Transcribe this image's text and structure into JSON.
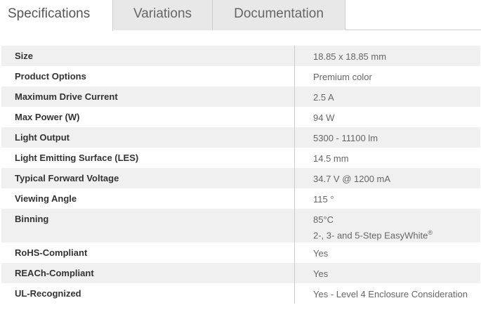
{
  "tabs": [
    {
      "label": "Specifications",
      "active": true
    },
    {
      "label": "Variations",
      "active": false
    },
    {
      "label": "Documentation",
      "active": false
    }
  ],
  "specs": [
    {
      "label": "Size",
      "value": "18.85 x 18.85 mm"
    },
    {
      "label": "Product Options",
      "value": "Premium color"
    },
    {
      "label": "Maximum Drive Current",
      "value": "2.5 A"
    },
    {
      "label": "Max Power (W)",
      "value": "94 W"
    },
    {
      "label": "Light Output",
      "value": "5300 - 11100 lm"
    },
    {
      "label": "Light Emitting Surface (LES)",
      "value": "14.5 mm"
    },
    {
      "label": "Typical Forward Voltage",
      "value": "34.7 V @ 1200 mA"
    },
    {
      "label": "Viewing Angle",
      "value": "115 °"
    },
    {
      "label": "Binning",
      "value": "85°C",
      "value2": "2-, 3- and 5-Step EasyWhite",
      "value2_sup": "®"
    },
    {
      "label": "RoHS-Compliant",
      "value": "Yes"
    },
    {
      "label": "REACh-Compliant",
      "value": "Yes"
    },
    {
      "label": "UL-Recognized",
      "value": "Yes - Level 4 Enclosure Consideration"
    }
  ]
}
